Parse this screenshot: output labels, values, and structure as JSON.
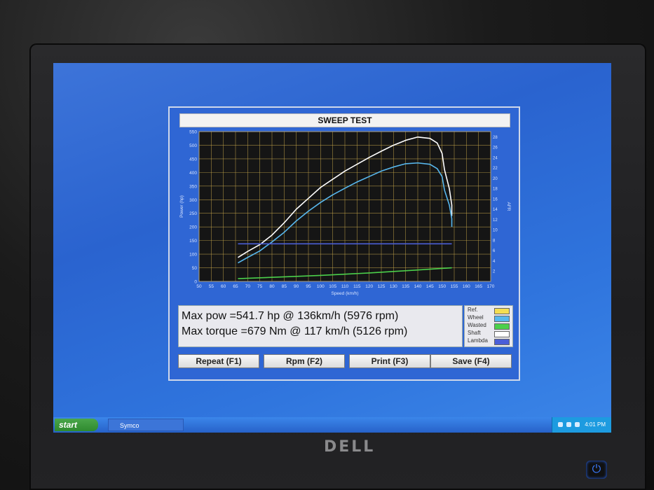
{
  "dialog": {
    "title": "SWEEP TEST",
    "info": {
      "line1": "Max pow =541.7 hp @ 136km/h (5976 rpm)",
      "line2": "Max torque =679 Nm @ 117 km/h (5126 rpm)"
    },
    "legend": [
      {
        "label": "Ref.",
        "color": "#f4de52"
      },
      {
        "label": "Wheel",
        "color": "#58b8ee"
      },
      {
        "label": "Wasted",
        "color": "#4bd04b"
      },
      {
        "label": "Shaft",
        "color": "#ffffff"
      },
      {
        "label": "Lambda",
        "color": "#4a5ed8"
      }
    ],
    "buttons": {
      "repeat": "Repeat (F1)",
      "rpm": "Rpm (F2)",
      "print": "Print (F3)",
      "save": "Save (F4)"
    }
  },
  "chart_data": {
    "type": "line",
    "xlabel": "Speed (km/h)",
    "ylabel": "Power (hp)",
    "y2label": "AFR",
    "xlim": [
      50,
      170
    ],
    "ylim": [
      0,
      550
    ],
    "y2lim": [
      0,
      29
    ],
    "xticks": [
      50,
      55,
      60,
      65,
      70,
      75,
      80,
      85,
      90,
      95,
      100,
      105,
      110,
      115,
      120,
      125,
      130,
      135,
      140,
      145,
      150,
      155,
      160,
      165,
      170
    ],
    "yticks": [
      0,
      50,
      100,
      150,
      200,
      250,
      300,
      350,
      400,
      450,
      500,
      550
    ],
    "y2ticks": [
      2,
      4,
      6,
      8,
      10,
      12,
      14,
      16,
      18,
      20,
      22,
      24,
      26,
      28
    ],
    "grid": true,
    "series": [
      {
        "name": "Shaft",
        "color": "#ffffff",
        "x": [
          66,
          70,
          75,
          80,
          85,
          90,
          95,
          100,
          105,
          110,
          115,
          120,
          125,
          130,
          135,
          140,
          145,
          148,
          150,
          151,
          153,
          154,
          154
        ],
        "y": [
          88,
          110,
          135,
          170,
          215,
          265,
          305,
          345,
          375,
          405,
          430,
          455,
          478,
          500,
          518,
          530,
          525,
          508,
          470,
          410,
          340,
          280,
          240
        ]
      },
      {
        "name": "Wheel",
        "color": "#58b8ee",
        "x": [
          66,
          70,
          75,
          80,
          85,
          90,
          95,
          100,
          105,
          110,
          115,
          120,
          125,
          130,
          135,
          140,
          145,
          148,
          150,
          151,
          153,
          154,
          154
        ],
        "y": [
          68,
          88,
          112,
          145,
          180,
          222,
          258,
          290,
          318,
          342,
          365,
          385,
          405,
          420,
          432,
          435,
          430,
          414,
          385,
          335,
          280,
          230,
          200
        ]
      },
      {
        "name": "Wasted",
        "color": "#4bd04b",
        "x": [
          66,
          80,
          100,
          120,
          140,
          154
        ],
        "y": [
          10,
          15,
          22,
          31,
          42,
          50
        ]
      },
      {
        "name": "Lambda",
        "color": "#4a5ed8",
        "x": [
          66,
          154
        ],
        "y": [
          138,
          138
        ]
      }
    ]
  },
  "taskbar": {
    "start": "start",
    "task": "Symco",
    "clock": "4:01 PM"
  },
  "brand": "DELL"
}
